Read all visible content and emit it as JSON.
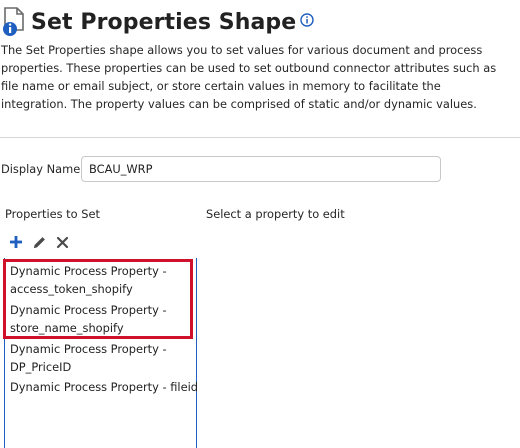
{
  "header": {
    "title": "Set Properties Shape",
    "document_icon": "document-info-icon",
    "info_icon": "info-icon"
  },
  "description": "The Set Properties shape allows you to set values for various document and process properties. These properties can be used to set outbound connector attributes such as file name or email subject, or store certain values in memory to facilitate the integration. The property values can be comprised of static and/or dynamic values.",
  "form": {
    "display_name_label": "Display Name",
    "display_name_value": "BCAU_WRP"
  },
  "properties": {
    "section_label": "Properties to Set",
    "edit_hint": "Select a property to edit",
    "toolbar": {
      "add_icon": "plus-icon",
      "edit_icon": "pencil-icon",
      "delete_icon": "close-icon"
    },
    "items": [
      {
        "line1": "Dynamic Process Property -",
        "line2": "access_token_shopify"
      },
      {
        "line1": "Dynamic Process Property -",
        "line2": "store_name_shopify"
      },
      {
        "line1": "Dynamic Process Property -",
        "line2": "DP_PriceID"
      },
      {
        "line1": "Dynamic Process Property - fileid",
        "line2": ""
      }
    ]
  },
  "colors": {
    "accent_blue": "#1f5fbf",
    "highlight_red": "#d0112b"
  }
}
